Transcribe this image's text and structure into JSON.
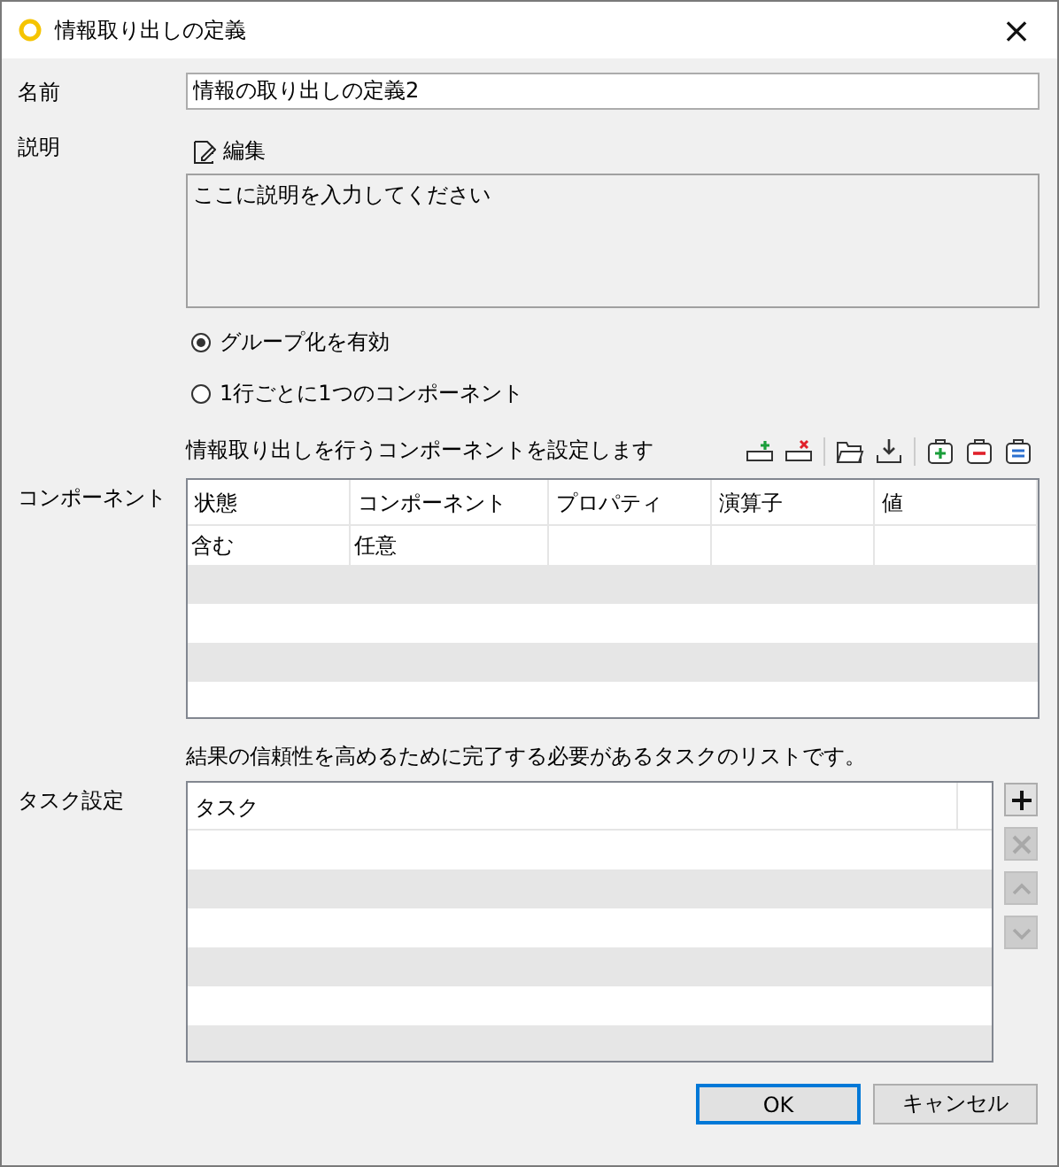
{
  "window": {
    "title": "情報取り出しの定義",
    "close": "×"
  },
  "name": {
    "label": "名前",
    "value": "情報の取り出しの定義2"
  },
  "description": {
    "label": "説明",
    "edit": "編集",
    "value": "ここに説明を入力してください"
  },
  "grouping": [
    {
      "label": "グループ化を有効",
      "selected": true
    },
    {
      "label": "1行ごとに1つのコンポーネント",
      "selected": false
    }
  ],
  "components": {
    "caption": "情報取り出しを行うコンポーネントを設定します",
    "label": "コンポーネント",
    "columns": [
      "状態",
      "コンポーネント",
      "プロパティ",
      "演算子",
      "値"
    ],
    "rows": [
      [
        "含む",
        "任意",
        "",
        "",
        ""
      ]
    ]
  },
  "tasks": {
    "caption": "結果の信頼性を高めるために完了する必要があるタスクのリストです。",
    "label": "タスク設定",
    "columns": [
      "タスク"
    ],
    "side_buttons": [
      {
        "kind": "add",
        "disabled": false
      },
      {
        "kind": "remove",
        "disabled": true
      },
      {
        "kind": "up",
        "disabled": true
      },
      {
        "kind": "down",
        "disabled": true
      }
    ]
  },
  "buttons": [
    {
      "label": "OK",
      "default": true
    },
    {
      "label": "キャンセル",
      "default": false
    }
  ]
}
